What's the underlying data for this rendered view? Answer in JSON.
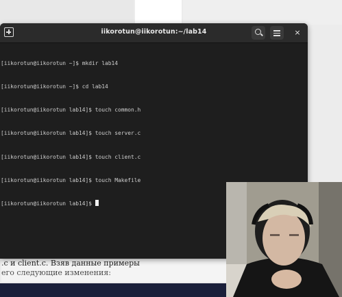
{
  "terminal": {
    "title": "iikorotun@iikorotun:~/lab14",
    "lines": [
      "[iikorotun@iikorotun ~]$ mkdir lab14",
      "[iikorotun@iikorotun ~]$ cd lab14",
      "[iikorotun@iikorotun lab14]$ touch common.h",
      "[iikorotun@iikorotun lab14]$ touch server.c",
      "[iikorotun@iikorotun lab14]$ touch client.c",
      "[iikorotun@iikorotun lab14]$ touch Makefile",
      "[iikorotun@iikorotun lab14]$ "
    ],
    "close_glyph": "×"
  },
  "background_doc": {
    "line1": ".c и client.c. Взяв данные примеры",
    "line2": "его следующие изменения:"
  }
}
